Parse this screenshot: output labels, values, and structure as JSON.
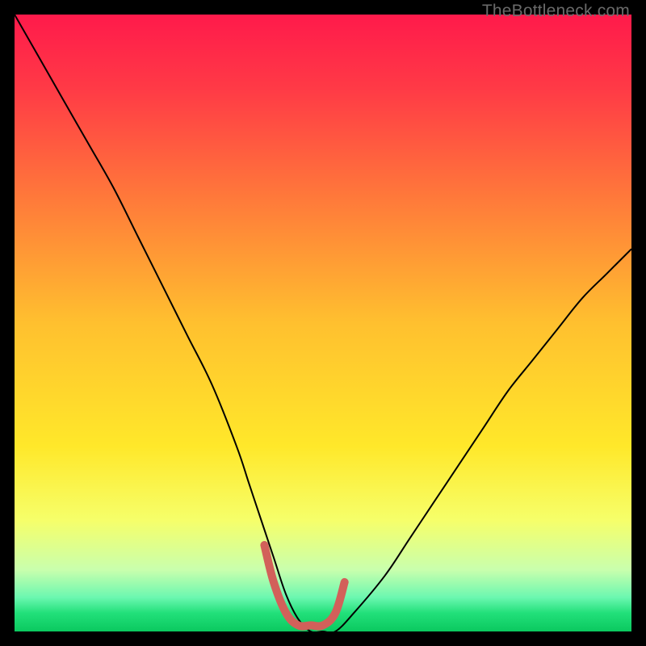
{
  "watermark": "TheBottleneck.com",
  "chart_data": {
    "type": "line",
    "title": "",
    "xlabel": "",
    "ylabel": "",
    "xlim": [
      0,
      100
    ],
    "ylim": [
      0,
      100
    ],
    "grid": false,
    "legend": false,
    "gradient_stops": [
      {
        "offset": 0.0,
        "color": "#ff1a4b"
      },
      {
        "offset": 0.12,
        "color": "#ff3a46"
      },
      {
        "offset": 0.3,
        "color": "#ff7a3a"
      },
      {
        "offset": 0.5,
        "color": "#ffc02f"
      },
      {
        "offset": 0.7,
        "color": "#ffe82a"
      },
      {
        "offset": 0.82,
        "color": "#f6ff6a"
      },
      {
        "offset": 0.9,
        "color": "#c9ffad"
      },
      {
        "offset": 0.945,
        "color": "#6bf7b0"
      },
      {
        "offset": 0.97,
        "color": "#22e07a"
      },
      {
        "offset": 1.0,
        "color": "#0bc95f"
      }
    ],
    "series": [
      {
        "name": "bottleneck-curve",
        "color": "#000000",
        "stroke_width": 2,
        "x": [
          0,
          4,
          8,
          12,
          16,
          20,
          24,
          28,
          32,
          36,
          38,
          40,
          42,
          44,
          46,
          48,
          50,
          52,
          55,
          60,
          64,
          68,
          72,
          76,
          80,
          84,
          88,
          92,
          96,
          100
        ],
        "y": [
          100,
          93,
          86,
          79,
          72,
          64,
          56,
          48,
          40,
          30,
          24,
          18,
          12,
          6,
          2,
          0,
          0,
          0,
          3,
          9,
          15,
          21,
          27,
          33,
          39,
          44,
          49,
          54,
          58,
          62
        ]
      },
      {
        "name": "optimal-zone",
        "color": "#d2605a",
        "stroke_width": 10,
        "linecap": "round",
        "x": [
          40.5,
          42,
          44,
          46,
          48,
          50,
          52,
          53.5
        ],
        "y": [
          14,
          8,
          3,
          1,
          1,
          1,
          3,
          8
        ]
      }
    ]
  }
}
